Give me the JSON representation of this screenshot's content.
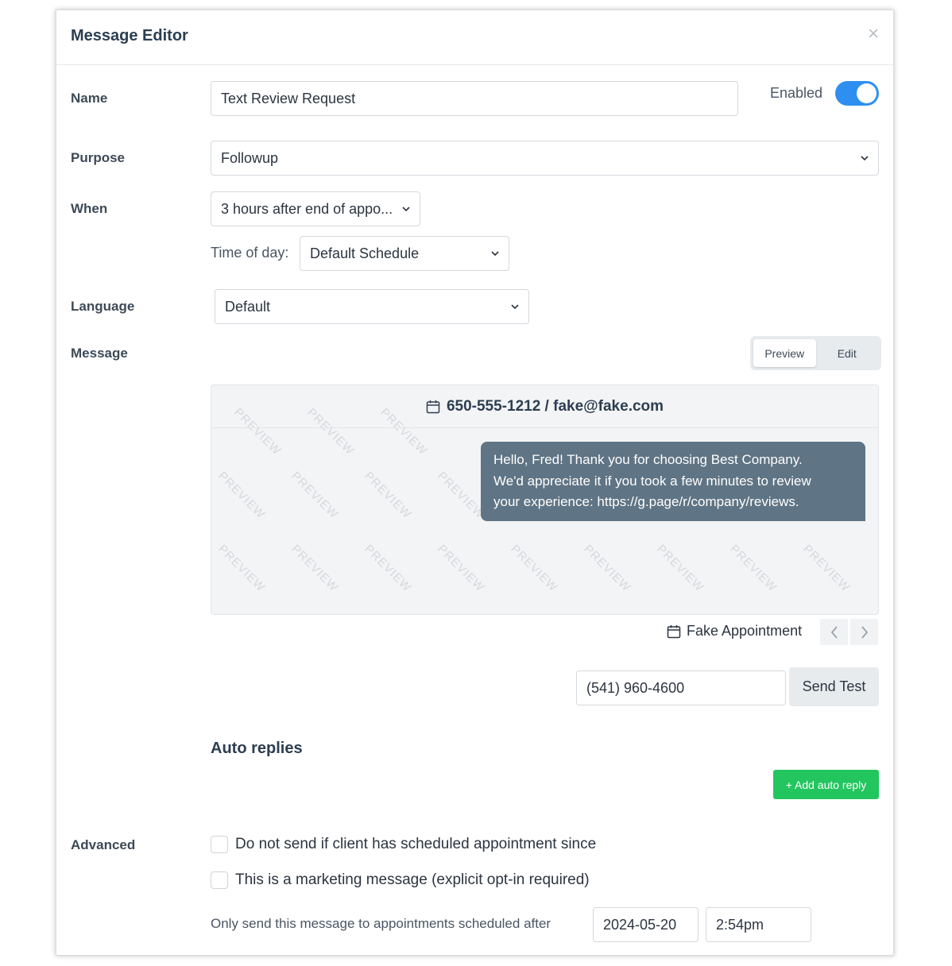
{
  "dialog": {
    "title": "Message Editor",
    "close_glyph": "×"
  },
  "name": {
    "label": "Name",
    "value": "Text Review Request"
  },
  "enabled": {
    "label": "Enabled",
    "on": true
  },
  "purpose": {
    "label": "Purpose",
    "value": "Followup"
  },
  "when": {
    "label": "When",
    "value": "3 hours after end of appo...",
    "time_of_day_label": "Time of day:",
    "time_of_day_value": "Default Schedule"
  },
  "language": {
    "label": "Language",
    "value": "Default"
  },
  "message": {
    "label": "Message",
    "tabs": [
      "Preview",
      "Edit"
    ],
    "active_tab": "Preview",
    "header": "650-555-1212 / fake@fake.com",
    "watermark": "PREVIEW",
    "bubble_lines": [
      "Hello, Fred! Thank you for choosing Best Company.",
      "We'd appreciate it if you took a few minutes to review",
      "your experience: https://g.page/r/company/reviews."
    ]
  },
  "appointment": {
    "label": "Fake Appointment",
    "prev_icon": "chevron-left-icon",
    "next_icon": "chevron-right-icon"
  },
  "test": {
    "phone": "(541) 960-4600",
    "button": "Send Test"
  },
  "auto_replies": {
    "title": "Auto replies",
    "add_button": "+ Add auto reply"
  },
  "advanced": {
    "label": "Advanced",
    "option1": "Do not send if client has scheduled appointment since",
    "option2": "This is a marketing message (explicit opt-in required)",
    "only_label": "Only send this message to appointments scheduled after",
    "date": "2024-05-20",
    "time": "2:54pm"
  },
  "colors": {
    "accent": "#2f8ff0",
    "bubble": "#5f7484",
    "success": "#22c55e"
  }
}
